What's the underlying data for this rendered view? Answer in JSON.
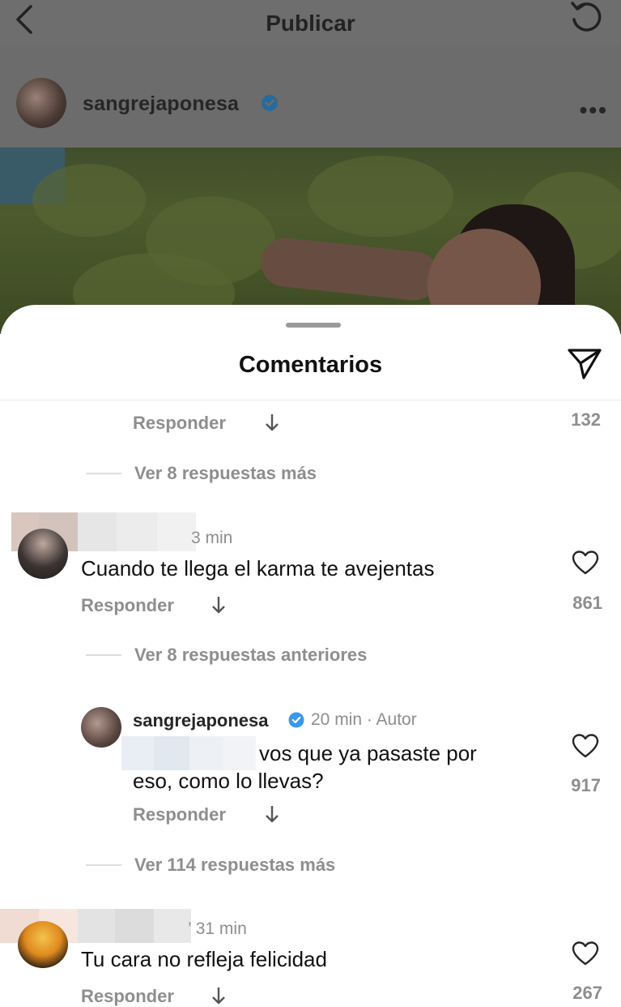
{
  "header": {
    "title": "Publicar"
  },
  "post": {
    "username": "sangrejaponesa"
  },
  "sheet": {
    "title": "Comentarios"
  },
  "colors": {
    "verified": "#3897f0",
    "muted": "#8e8e8e"
  },
  "comments": [
    {
      "reply_label": "Responder",
      "likes": "132",
      "more_replies": "Ver 8 respuestas más"
    },
    {
      "time": "3 min",
      "text": "Cuando te llega el karma te avejentas",
      "reply_label": "Responder",
      "likes": "861",
      "prev_replies": "Ver 8 respuestas anteriores",
      "reply": {
        "username": "sangrejaponesa",
        "time": "20 min · Autor",
        "text_line1": "vos que ya pasaste por",
        "text_line2": "eso, como lo llevas?",
        "reply_label": "Responder",
        "likes": "917"
      },
      "more_replies": "Ver 114 respuestas más"
    },
    {
      "time": "31 min",
      "text": "Tu cara no refleja felicidad",
      "reply_label": "Responder",
      "likes": "267"
    }
  ]
}
